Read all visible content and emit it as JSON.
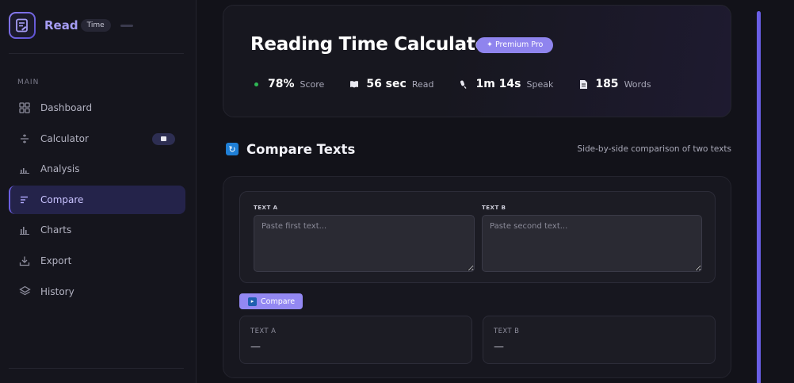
{
  "colors": {
    "accent": "#8f84ee",
    "background": "#121219",
    "sidebar": "#15151d",
    "card": "#17171f",
    "active_nav": "#24234a",
    "score_dot": "#2fb855",
    "scroll_accent": "#6a5fe6"
  },
  "brand": {
    "name": "Read",
    "pill": "Time",
    "icon": "document-edit-icon"
  },
  "sidebar": {
    "section_label": "MAIN",
    "items": [
      {
        "label": "Dashboard",
        "icon": "grid-icon",
        "active": false
      },
      {
        "label": "Calculator",
        "icon": "calculator-icon",
        "active": false,
        "badge_icon": "book-icon"
      },
      {
        "label": "Analysis",
        "icon": "bar-chart-icon",
        "active": false
      },
      {
        "label": "Compare",
        "icon": "lines-icon",
        "active": true
      },
      {
        "label": "Charts",
        "icon": "chart-icon",
        "active": false
      },
      {
        "label": "Export",
        "icon": "download-icon",
        "active": false
      },
      {
        "label": "History",
        "icon": "layers-icon",
        "active": false
      }
    ]
  },
  "hero": {
    "title": "Reading Time Calculator",
    "badge": "✦ Premium Pro",
    "stats": [
      {
        "icon": "green-dot-icon",
        "value": "78%",
        "label": "Score"
      },
      {
        "icon": "book-icon",
        "value": "56 sec",
        "label": "Read"
      },
      {
        "icon": "microphone-icon",
        "value": "1m 14s",
        "label": "Speak"
      },
      {
        "icon": "document-icon",
        "value": "185",
        "label": "Words"
      }
    ]
  },
  "compare": {
    "title": "Compare Texts",
    "subtitle": "Side-by-side comparison of two texts",
    "icon": "refresh-icon",
    "text_a_label": "TEXT A",
    "text_b_label": "TEXT B",
    "text_a_placeholder": "Paste first text...",
    "text_b_placeholder": "Paste second text...",
    "text_a_value": "",
    "text_b_value": "",
    "button_label": "Compare",
    "button_icon": "compare-icon",
    "result_a_label": "TEXT A",
    "result_b_label": "TEXT B",
    "result_a_value": "—",
    "result_b_value": "—"
  }
}
